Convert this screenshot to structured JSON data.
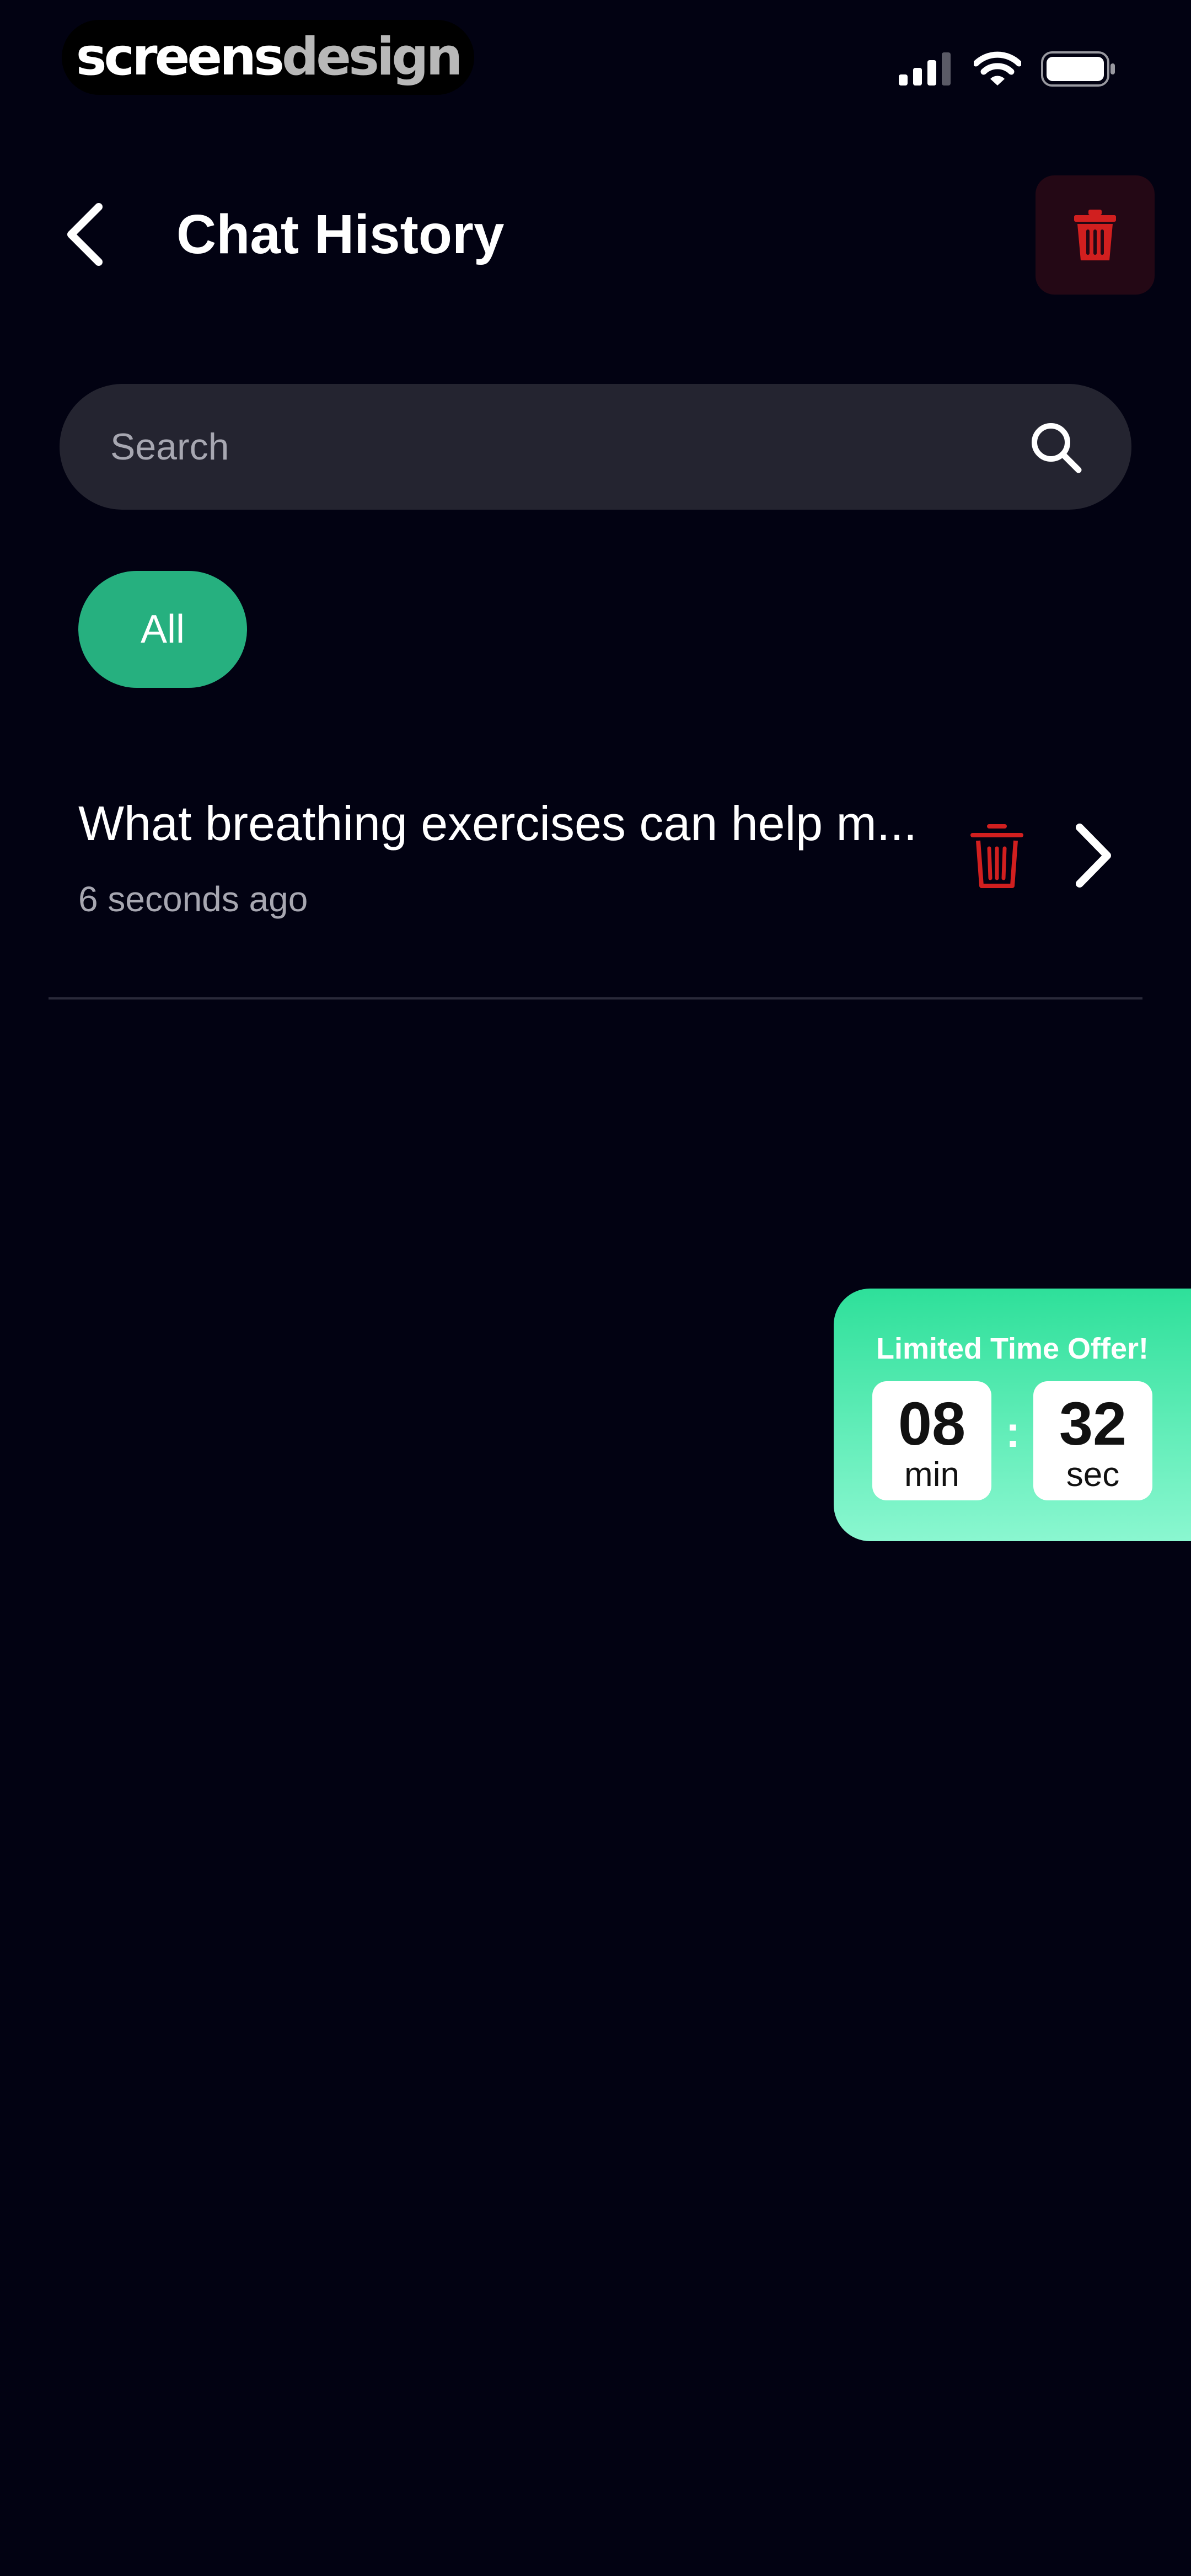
{
  "status_bar": {
    "brand_part1": "screens",
    "brand_part2": "design",
    "icons": [
      "signal-icon",
      "wifi-icon",
      "battery-icon"
    ]
  },
  "header": {
    "title": "Chat History",
    "back_icon": "chevron-left-icon",
    "delete_all_icon": "trash-icon"
  },
  "search": {
    "placeholder": "Search",
    "value": ""
  },
  "filters": [
    {
      "label": "All",
      "selected": true
    }
  ],
  "chats": [
    {
      "title": "What breathing exercises can help m...",
      "time": "6 seconds ago"
    }
  ],
  "offer": {
    "title": "Limited Time Offer!",
    "minutes": "08",
    "minutes_unit": "min",
    "separator": ":",
    "seconds": "32",
    "seconds_unit": "sec"
  },
  "colors": {
    "background": "#020212",
    "accent_green": "#26b07f",
    "danger_red": "#d11f1f",
    "search_bg": "#242430",
    "secondary_text": "#a7a7b1"
  }
}
